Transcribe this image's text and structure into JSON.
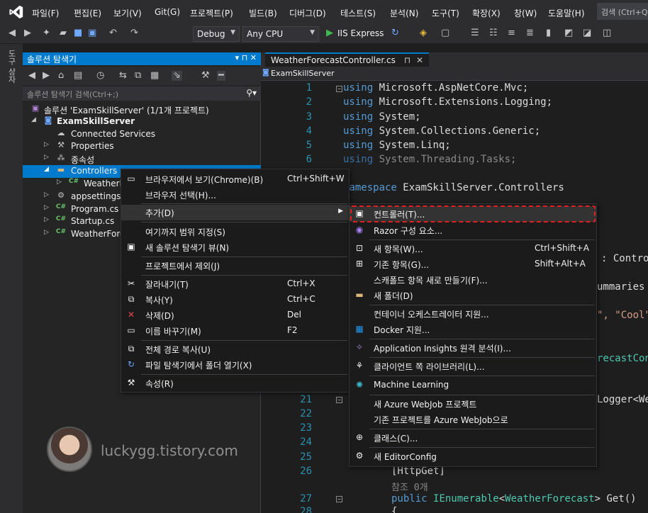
{
  "menubar": {
    "items": [
      "파일(F)",
      "편집(E)",
      "보기(V)",
      "Git(G)",
      "프로젝트(P)",
      "빌드(B)",
      "디버그(D)",
      "테스트(S)",
      "분석(N)",
      "도구(T)",
      "확장(X)",
      "창(W)",
      "도움말(H)"
    ],
    "search": "검색 (Ctrl+Q)"
  },
  "toolbar": {
    "config": "Debug",
    "platform": "Any CPU",
    "run_label": "IIS Express"
  },
  "side_strip": {
    "tab_label": "도구 상자"
  },
  "solution_explorer": {
    "title": "솔루션 탐색기",
    "search_placeholder": "솔루션 탐색기 검색(Ctrl+;)",
    "tree": [
      {
        "label": "솔루션 'ExamSkillServer' (1/1개 프로젝트)",
        "icon": "solution-icon"
      },
      {
        "label": "ExamSkillServer",
        "icon": "project-icon"
      },
      {
        "label": "Connected Services",
        "icon": "cloud-icon"
      },
      {
        "label": "Properties",
        "icon": "wrench-icon"
      },
      {
        "label": "종속성",
        "icon": "dependency-icon"
      },
      {
        "label": "Controllers",
        "icon": "folder-icon"
      },
      {
        "label": "WeatherForecastController.cs",
        "icon": "csharp-file-icon"
      },
      {
        "label": "appsettings.json",
        "icon": "json-file-icon"
      },
      {
        "label": "Program.cs",
        "icon": "csharp-file-icon"
      },
      {
        "label": "Startup.cs",
        "icon": "csharp-file-icon"
      },
      {
        "label": "WeatherForecast.cs",
        "icon": "csharp-file-icon"
      }
    ]
  },
  "editor": {
    "tab": "WeatherForecastController.cs",
    "nav": "ExamSkillServer",
    "lines": [
      {
        "n": "1",
        "text": "using Microsoft.AspNetCore.Mvc;"
      },
      {
        "n": "2",
        "text": "using Microsoft.Extensions.Logging;"
      },
      {
        "n": "3",
        "text": "using System;"
      },
      {
        "n": "4",
        "text": "using System.Collections.Generic;"
      },
      {
        "n": "5",
        "text": "using System.Linq;"
      },
      {
        "n": "6",
        "text": "using System.Threading.Tasks;"
      },
      {
        "n": "",
        "text": "namespace ExamSkillServer.Controllers"
      },
      {
        "n": "",
        "text": ": Contro"
      },
      {
        "n": "",
        "text": "ummaries"
      },
      {
        "n": "",
        "text": "\", \"Cool\""
      },
      {
        "n": "",
        "text": "recastCon"
      },
      {
        "n": "21",
        "text": "Logger<We"
      },
      {
        "n": "22",
        "text": ""
      },
      {
        "n": "23",
        "text": ""
      },
      {
        "n": "24",
        "text": ""
      },
      {
        "n": "25",
        "text": ""
      },
      {
        "n": "26",
        "text": "[HttpGet]"
      },
      {
        "n": "",
        "text": "참조 0개"
      },
      {
        "n": "27",
        "text": "public IEnumerable<WeatherForecast> Get()"
      },
      {
        "n": "28",
        "text": "{"
      }
    ]
  },
  "context_menu": {
    "items": [
      {
        "label": "브라우저에서 보기(Chrome)(B)",
        "shortcut": "Ctrl+Shift+W",
        "icon": "browser-icon"
      },
      {
        "label": "브라우저 선택(H)...",
        "shortcut": "",
        "icon": ""
      },
      {
        "label": "추가(D)",
        "shortcut": "",
        "icon": ""
      },
      {
        "label": "여기까지 범위 지정(S)",
        "shortcut": "",
        "icon": ""
      },
      {
        "label": "새 솔루션 탐색기 뷰(N)",
        "shortcut": "",
        "icon": "new-view-icon"
      },
      {
        "label": "프로젝트에서 제외(J)",
        "shortcut": "",
        "icon": ""
      },
      {
        "label": "잘라내기(T)",
        "shortcut": "Ctrl+X",
        "icon": "scissors-icon"
      },
      {
        "label": "복사(Y)",
        "shortcut": "Ctrl+C",
        "icon": "copy-icon"
      },
      {
        "label": "삭제(D)",
        "shortcut": "Del",
        "icon": "delete-icon"
      },
      {
        "label": "이름 바꾸기(M)",
        "shortcut": "F2",
        "icon": "rename-icon"
      },
      {
        "label": "전체 경로 복사(U)",
        "shortcut": "",
        "icon": "copy-path-icon"
      },
      {
        "label": "파일 탐색기에서 폴더 열기(X)",
        "shortcut": "",
        "icon": "refresh-icon"
      },
      {
        "label": "속성(R)",
        "shortcut": "",
        "icon": "wrench-icon"
      }
    ]
  },
  "submenu": {
    "items": [
      {
        "label": "컨트롤러(T)...",
        "shortcut": "",
        "icon": "controller-icon"
      },
      {
        "label": "Razor 구성 요소...",
        "shortcut": "",
        "icon": "razor-icon"
      },
      {
        "label": "새 항목(W)...",
        "shortcut": "Ctrl+Shift+A",
        "icon": "new-item-icon"
      },
      {
        "label": "기존 항목(G)...",
        "shortcut": "Shift+Alt+A",
        "icon": "existing-item-icon"
      },
      {
        "label": "스캐폴드 항목 새로 만들기(F)...",
        "shortcut": "",
        "icon": ""
      },
      {
        "label": "새 폴더(D)",
        "shortcut": "",
        "icon": "new-folder-icon"
      },
      {
        "label": "컨테이너 오케스트레이터 지원...",
        "shortcut": "",
        "icon": ""
      },
      {
        "label": "Docker 지원...",
        "shortcut": "",
        "icon": "docker-icon"
      },
      {
        "label": "Application Insights 원격 분석(I)...",
        "shortcut": "",
        "icon": "insights-icon"
      },
      {
        "label": "클라이언트 쪽 라이브러리(L)...",
        "shortcut": "",
        "icon": "library-icon"
      },
      {
        "label": "Machine Learning",
        "shortcut": "",
        "icon": "ml-icon"
      },
      {
        "label": "새 Azure WebJob 프로젝트",
        "shortcut": "",
        "icon": ""
      },
      {
        "label": "기존 프로젝트를 Azure WebJob으로",
        "shortcut": "",
        "icon": ""
      },
      {
        "label": "클래스(C)...",
        "shortcut": "",
        "icon": "class-icon"
      },
      {
        "label": "새 EditorConfig",
        "shortcut": "",
        "icon": "editorconfig-icon"
      }
    ]
  },
  "watermark": {
    "text": "luckygg.tistory.com"
  }
}
